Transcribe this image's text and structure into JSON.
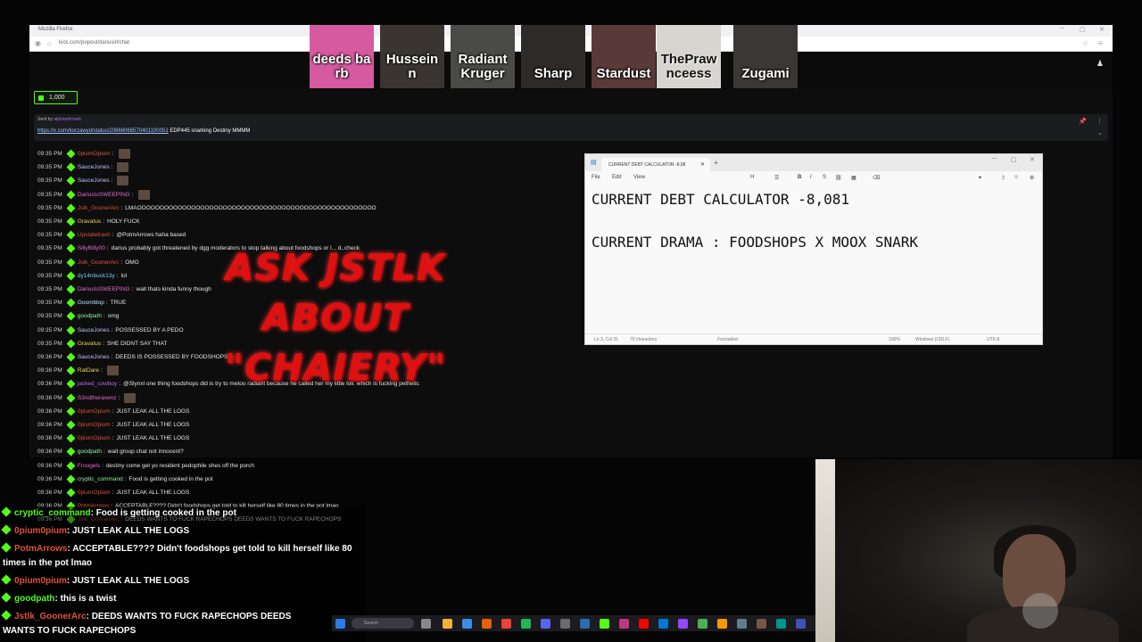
{
  "browser": {
    "window_title": "Mozilla Firefox",
    "url": "kick.com/popout/dariusirl/chat"
  },
  "thumbnails": [
    {
      "name": "deeds barb",
      "color": "#d65aa0"
    },
    {
      "name": "Husseinn",
      "color": "#3a3530"
    },
    {
      "name": "Radiant Kruger",
      "color": "#4a4a48"
    },
    {
      "name": "Sharp",
      "color": "#2e2a28"
    },
    {
      "name": "Stardust",
      "color": "#5a3a38"
    },
    {
      "name": "ThePrawnceess",
      "color": "#d8d4d0"
    },
    {
      "name": "Zugami",
      "color": "#3a3836"
    }
  ],
  "gift_badge": "1,000",
  "pinned": {
    "sent_by_label": "Sent by",
    "sent_by_user": "alphandrnoob",
    "link": "https://x.com/korzawyd/status/20866066570401100051",
    "text": "EDP445 snarking Destiny MMMM"
  },
  "chat": [
    {
      "time": "09:35 PM",
      "user": "0piumOpium",
      "color": "#e0503c",
      "text": ""
    },
    {
      "time": "09:35 PM",
      "user": "SauceJones",
      "color": "#c0c0ff",
      "text": ""
    },
    {
      "time": "09:35 PM",
      "user": "SauceJones",
      "color": "#c0c0ff",
      "text": ""
    },
    {
      "time": "09:35 PM",
      "user": "DariusIsSWEEPING",
      "color": "#e76ad0",
      "text": ""
    },
    {
      "time": "09:35 PM",
      "user": "Jstk_GoonerArc",
      "color": "#e0503c",
      "text": "LMAOOOOOOOOOOOOOOOOOOOOOOOOOOOOOOOOOOOOOOOOOOOOOOOOOOOOO"
    },
    {
      "time": "09:35 PM",
      "user": "Gravatus",
      "color": "#f4d35e",
      "text": "HOLY FUCK"
    },
    {
      "time": "09:35 PM",
      "user": "Upstatetrash",
      "color": "#e0503c",
      "text": "@PotmArrows haha based"
    },
    {
      "time": "09:35 PM",
      "user": "SillyBilly00",
      "color": "#e76ad0",
      "text": "darius probably got threatened by dgg moderators to stop talking about foodshops or l... d,.check"
    },
    {
      "time": "09:35 PM",
      "user": "Jstk_GoonerArc",
      "color": "#e0503c",
      "text": "OMG"
    },
    {
      "time": "09:35 PM",
      "user": "dy14nbuck13y",
      "color": "#7ecbff",
      "text": "lol"
    },
    {
      "time": "09:35 PM",
      "user": "DariusIsSWEEPING",
      "color": "#e76ad0",
      "text": "wait thats kinda funny though"
    },
    {
      "time": "09:35 PM",
      "user": "Goomblop",
      "color": "#bfe3ff",
      "text": "TRUE"
    },
    {
      "time": "09:35 PM",
      "user": "goodpath",
      "color": "#8ef0a0",
      "text": "omg"
    },
    {
      "time": "09:35 PM",
      "user": "SauceJones",
      "color": "#c0c0ff",
      "text": "POSSESSED BY A PEDO"
    },
    {
      "time": "09:35 PM",
      "user": "Gravatus",
      "color": "#f4d35e",
      "text": "SHE DIDNT SAY THAT"
    },
    {
      "time": "09:36 PM",
      "user": "SauceJones",
      "color": "#c0c0ff",
      "text": "DEEDS IS POSSESSED BY FOODSHOPS"
    },
    {
      "time": "09:36 PM",
      "user": "RatDare",
      "color": "#f4d35e",
      "text": ""
    },
    {
      "time": "09:36 PM",
      "user": "jacked_cowboy",
      "color": "#b56af0",
      "text": "@Slynxl one thing foodshops did is try to metoo radiant because he called her my little loli. which is fucking pethetic"
    },
    {
      "time": "09:36 PM",
      "user": "S3ndtheravenz",
      "color": "#e76ad0",
      "text": ""
    },
    {
      "time": "09:36 PM",
      "user": "0piumOpium",
      "color": "#e0503c",
      "text": "JUST LEAK ALL THE LOGS"
    },
    {
      "time": "09:36 PM",
      "user": "0piumOpium",
      "color": "#e0503c",
      "text": "JUST LEAK ALL THE LOGS"
    },
    {
      "time": "09:36 PM",
      "user": "0piumOpium",
      "color": "#e0503c",
      "text": "JUST LEAK ALL THE LOGS"
    },
    {
      "time": "09:36 PM",
      "user": "goodpath",
      "color": "#8ef0a0",
      "text": "wait group chat not innocent?"
    },
    {
      "time": "09:36 PM",
      "user": "Froogels",
      "color": "#e76ad0",
      "text": "destiny come get yo resident pedophile shes off the porch"
    },
    {
      "time": "09:36 PM",
      "user": "cryptic_command",
      "color": "#8ef0a0",
      "text": "Food is getting cooked in the pot"
    },
    {
      "time": "09:36 PM",
      "user": "0piumOpium",
      "color": "#e0503c",
      "text": "JUST LEAK ALL THE LOGS"
    },
    {
      "time": "09:36 PM",
      "user": "PotmArrows",
      "color": "#e0503c",
      "text": "ACCEPTABLE???? Didn't foodshops get told to kill herself like 80 times in the pot lmao"
    },
    {
      "time": "09:36 PM",
      "user": "Jstk_GoonerArc",
      "color": "#e0503c",
      "text": "DEEDS WANTS TO FUCK RAPECHOPS  DEEDS WANTS TO FUCK RAPECHOPS"
    }
  ],
  "overlay_text": [
    "ASK JSTLK",
    "ABOUT",
    "\"CHAIERY\""
  ],
  "notepad": {
    "tab_title": "CURRENT DEBT CALCULATOR -8,08",
    "menu": [
      "File",
      "Edit",
      "View"
    ],
    "lines": [
      "CURRENT DEBT CALCULATOR -8,081",
      "CURRENT DRAMA : FOODSHOPS X MOOX SNARK"
    ],
    "status": {
      "position": "Ln 3, Col 31",
      "chars": "70 characters",
      "format": "Formatted",
      "zoom": "100%",
      "eol": "Windows (CRLF)",
      "encoding": "UTF-8"
    }
  },
  "captions": [
    {
      "user": "cryptic_command",
      "text": ": Food is getting cooked in the pot",
      "color": "#53fc18"
    },
    {
      "user": "0pium0pium",
      "text": ": JUST LEAK ALL THE LOGS",
      "color": "#e0503c"
    },
    {
      "user": "PotmArrows",
      "text": ": ACCEPTABLE???? Didn't foodshops get told to kill herself like 80",
      "color": "#e0503c"
    },
    {
      "user": "",
      "text": "times in the pot lmao",
      "color": "#ffffff"
    },
    {
      "user": "0pium0pium",
      "text": ": JUST LEAK ALL THE LOGS",
      "color": "#e0503c"
    },
    {
      "user": "goodpath",
      "text": ": this is a twist",
      "color": "#53fc18"
    },
    {
      "user": "Jstlk_GoonerArc",
      "text": ":  DEEDS WANTS TO FUCK RAPECHOPS  DEEDS",
      "color": "#e0503c"
    },
    {
      "user": "",
      "text": "WANTS TO FUCK RAPECHOPS",
      "color": "#ffffff"
    }
  ],
  "taskbar": {
    "search_placeholder": "Search"
  }
}
